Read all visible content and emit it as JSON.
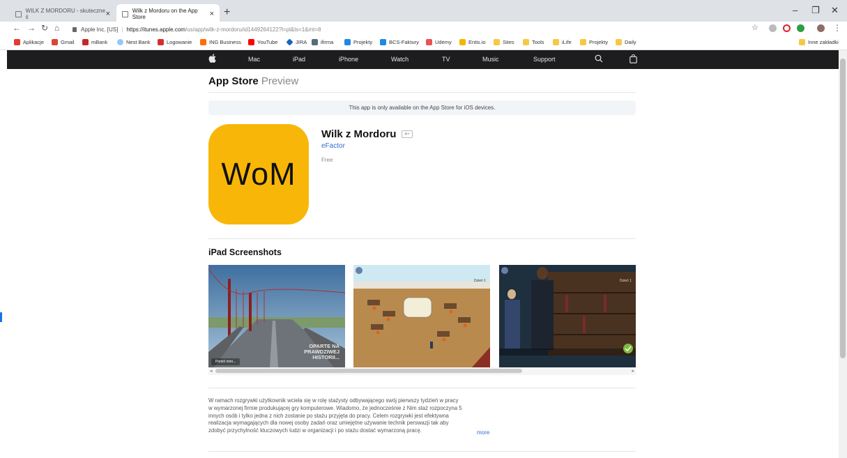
{
  "tabs": [
    {
      "title": "WILK Z MORDORU - skuteczne ś"
    },
    {
      "title": "Wilk z Mordoru on the App Store"
    }
  ],
  "address": {
    "site_identity": "Apple Inc. [US]",
    "url_host": "https://itunes.apple.com",
    "url_path": "/us/app/wilk-z-mordoru/id1449264122?l=pl&ls=1&mt=8"
  },
  "bookmarks": [
    {
      "label": "Aplikacje",
      "color": "#e53935"
    },
    {
      "label": "Gmail",
      "color": "#db4437"
    },
    {
      "label": "mBank",
      "color": "#c62828"
    },
    {
      "label": "Nest Bank",
      "color": "#90caf9"
    },
    {
      "label": "Logowanie",
      "color": "#d32f2f"
    },
    {
      "label": "ING Business",
      "color": "#ff6f00"
    },
    {
      "label": "YouTube",
      "color": "#ff0000"
    },
    {
      "label": "JIRA",
      "color": "#1565c0"
    },
    {
      "label": "ifirma",
      "color": "#546e7a"
    },
    {
      "label": "Projekty",
      "color": "#1e88e5"
    },
    {
      "label": "BCS-Faktury",
      "color": "#1e88e5"
    },
    {
      "label": "Udemy",
      "color": "#ec5252"
    },
    {
      "label": "Entis.io",
      "color": "#f4b400"
    },
    {
      "label": "Sites",
      "color": "#f6c844"
    },
    {
      "label": "Tools",
      "color": "#f6c844"
    },
    {
      "label": "iLife",
      "color": "#f6c844"
    },
    {
      "label": "Projekty",
      "color": "#f6c844"
    },
    {
      "label": "Daily",
      "color": "#f6c844"
    }
  ],
  "bookmarks_other": "Inne zakładki",
  "apple_nav": [
    "Mac",
    "iPad",
    "iPhone",
    "Watch",
    "TV",
    "Music",
    "Support"
  ],
  "store": {
    "title_bold": "App Store",
    "title_light": "Preview",
    "notice": "This app is only available on the App Store for iOS devices."
  },
  "app": {
    "icon_text": "WoM",
    "icon_color": "#f8b708",
    "name": "Wilk z Mordoru",
    "age_rating": "4+",
    "developer": "eFactor",
    "price": "Free"
  },
  "screenshots": {
    "heading": "iPad Screenshots",
    "shot1_caption": "OPARTE NA PRAWDZIWEJ HISTORII...",
    "shot1_button": "Pomiń intro...",
    "shot2_label": "Dzień 1",
    "shot3_label": "Dzień 1"
  },
  "description": {
    "lines": [
      "W ramach rozgrywki użytkownik wciela się w rolę stażysty odbywającego swój pierwszy tydzień w pracy",
      "w wymarzonej firmie produkującej gry komputerowe. Wiadomo, że jednocześnie z Nim staż rozpoczyna 5",
      "innych osób i tylko jedna z nich zostanie po stażu przyjęta do pracy. Celem rozgrywki jest efektywna",
      "realizacja wymagających dla nowej osoby zadań oraz umiejętne używanie technik perswazji tak aby",
      "zdobyć przychylność kluczowych ludzi w organizacji i po stażu dostać wymarzoną pracę."
    ],
    "more_label": "more"
  }
}
